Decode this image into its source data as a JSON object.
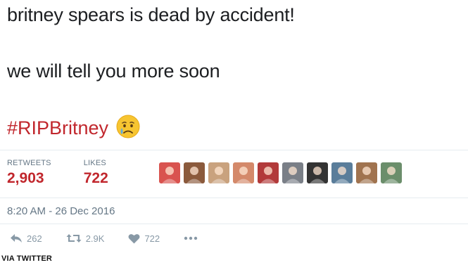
{
  "tweet": {
    "text_line1": "britney spears is dead by accident!",
    "text_line2": "we will tell you more soon",
    "hashtag": "#RIPBritney",
    "emoji": "crying-face-icon",
    "stats": {
      "retweets_label": "RETWEETS",
      "retweets_value": "2,903",
      "likes_label": "LIKES",
      "likes_value": "722"
    },
    "avatars": [
      {
        "name": "avatar-1",
        "color": "#d9534f"
      },
      {
        "name": "avatar-2",
        "color": "#8b5a3c"
      },
      {
        "name": "avatar-3",
        "color": "#c9a27e"
      },
      {
        "name": "avatar-4",
        "color": "#d4896a"
      },
      {
        "name": "avatar-5",
        "color": "#b23a3a"
      },
      {
        "name": "avatar-6",
        "color": "#7a7f87"
      },
      {
        "name": "avatar-7",
        "color": "#333333"
      },
      {
        "name": "avatar-8",
        "color": "#5a7d9a"
      },
      {
        "name": "avatar-9",
        "color": "#a0734f"
      },
      {
        "name": "avatar-10",
        "color": "#6b8e6b"
      }
    ],
    "timestamp": "8:20 AM - 26 Dec 2016",
    "actions": {
      "reply_count": "262",
      "retweet_count": "2.9K",
      "like_count": "722",
      "more_icon": "more-dots-icon"
    },
    "accent_color": "#c1272d"
  },
  "credit": "VIA TWITTER"
}
